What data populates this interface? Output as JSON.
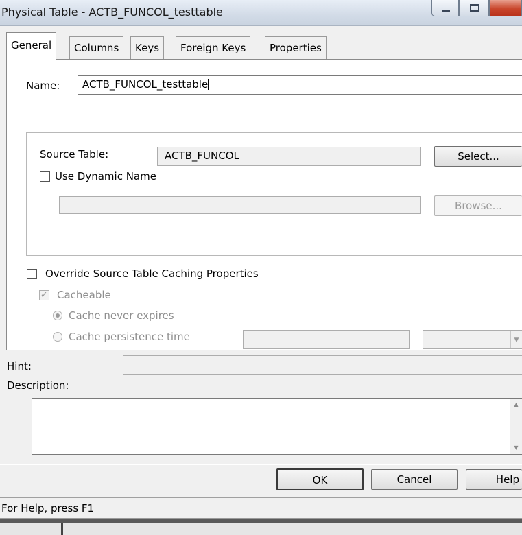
{
  "window": {
    "title": "Physical Table - ACTB_FUNCOL_testtable"
  },
  "tabs": [
    {
      "label": "General",
      "active": true
    },
    {
      "label": "Columns",
      "active": false
    },
    {
      "label": "Keys",
      "active": false
    },
    {
      "label": "Foreign Keys",
      "active": false
    },
    {
      "label": "Properties",
      "active": false
    }
  ],
  "general": {
    "name_label": "Name:",
    "name_value": "ACTB_FUNCOL_testtable",
    "source_table_label": "Source Table:",
    "source_table_value": "ACTB_FUNCOL",
    "select_button": "Select...",
    "use_dynamic_name_label": "Use Dynamic Name",
    "use_dynamic_name_checked": false,
    "dynamic_name_value": "",
    "browse_button": "Browse...",
    "override_caching_label": "Override Source Table Caching Properties",
    "override_caching_checked": false,
    "cacheable_label": "Cacheable",
    "cacheable_checked": true,
    "cache_never_expires_label": "Cache never expires",
    "cache_persistence_label": "Cache persistence time",
    "cache_mode_selected": "Cache never expires",
    "persistence_value": "",
    "persistence_unit": "",
    "hint_label": "Hint:",
    "hint_value": "",
    "description_label": "Description:",
    "description_value": ""
  },
  "buttons": {
    "ok": "OK",
    "cancel": "Cancel",
    "help": "Help"
  },
  "status_bar": {
    "text": "For Help, press F1"
  },
  "colors": {
    "close_button": "#c9462c",
    "dialog_bg": "#f0f0f0",
    "panel_bg": "#ffffff"
  }
}
